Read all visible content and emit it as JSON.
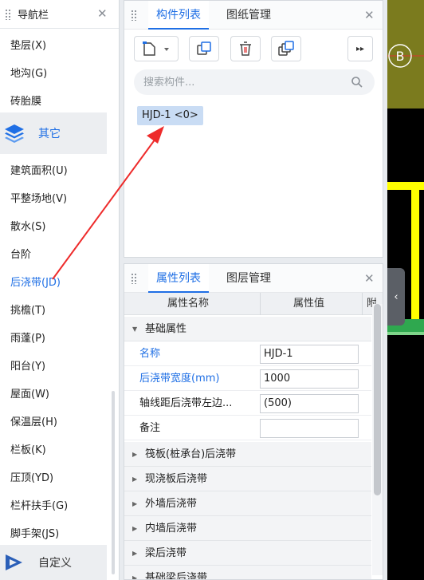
{
  "nav": {
    "title": "导航栏",
    "items_top": [
      "垫层(X)",
      "地沟(G)",
      "砖胎膜"
    ],
    "group_other": "其它",
    "items": [
      "建筑面积(U)",
      "平整场地(V)",
      "散水(S)",
      "台阶",
      "后浇带(JD)",
      "挑檐(T)",
      "雨蓬(P)",
      "阳台(Y)",
      "屋面(W)",
      "保温层(H)",
      "栏板(K)",
      "压顶(YD)",
      "栏杆扶手(G)",
      "脚手架(JS)"
    ],
    "active_item": "后浇带(JD)",
    "group_custom": "自定义"
  },
  "component_panel": {
    "tab_active": "构件列表",
    "tab_inactive": "图纸管理",
    "search_placeholder": "搜索构件...",
    "items": [
      "HJD-1 <0>"
    ]
  },
  "property_panel": {
    "tab_active": "属性列表",
    "tab_inactive": "图层管理",
    "col_name": "属性名称",
    "col_value": "属性值",
    "col_extra": "附",
    "section_basic": "基础属性",
    "rows": [
      {
        "name": "名称",
        "value": "HJD-1"
      },
      {
        "name": "后浇带宽度(mm)",
        "value": "1000"
      },
      {
        "name": "轴线距后浇带左边...",
        "value": "(500)"
      },
      {
        "name": "备注",
        "value": ""
      }
    ],
    "sections": [
      "筏板(桩承台)后浇带",
      "现浇板后浇带",
      "外墙后浇带",
      "内墙后浇带",
      "梁后浇带",
      "基础梁后浇带"
    ]
  },
  "canvas": {
    "axis_label": "B",
    "canvas_bg": "#000000",
    "olive_color": "#7b7b1e",
    "yellow_color": "#ffff00",
    "green_color": "#2fa84f"
  },
  "annotation": {
    "arrow_color": "#ee2b2b"
  },
  "colors": {
    "accent": "#1f6fe5",
    "selected_bg": "#c9dcf4"
  }
}
